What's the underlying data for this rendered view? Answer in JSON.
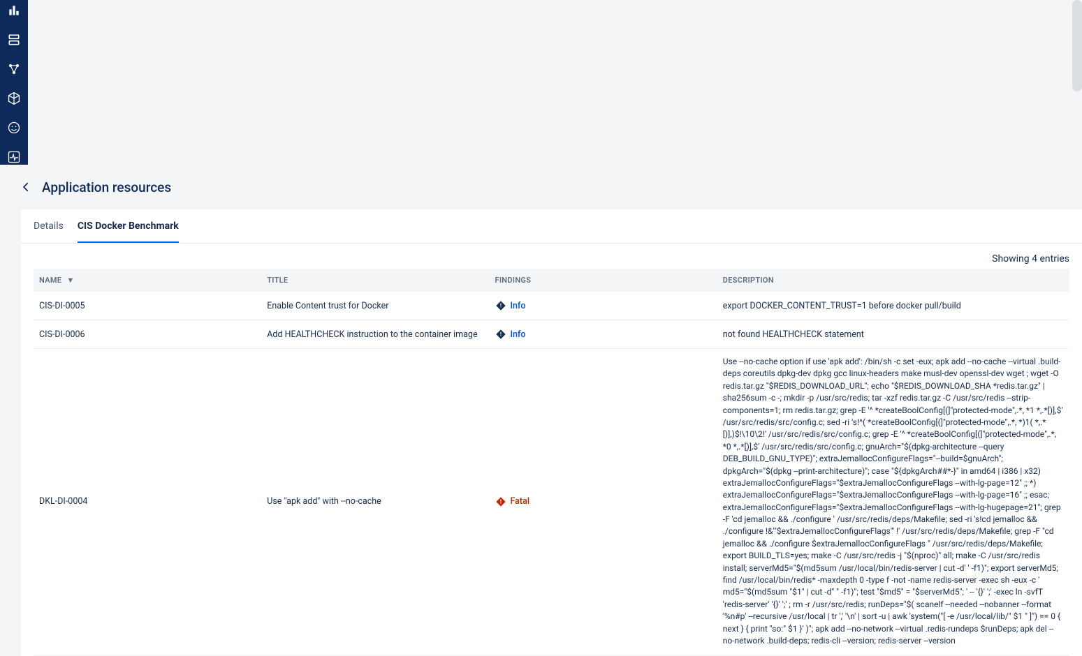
{
  "sidebar": {
    "icons": [
      {
        "name": "bar-chart-icon"
      },
      {
        "name": "server-icon"
      },
      {
        "name": "nodes-icon"
      },
      {
        "name": "cube-icon"
      },
      {
        "name": "smiley-icon"
      },
      {
        "name": "activity-icon"
      }
    ]
  },
  "header": {
    "title": "Application resources"
  },
  "tabs": {
    "items": [
      {
        "label": "Details",
        "active": false
      },
      {
        "label": "CIS Docker Benchmark",
        "active": true
      }
    ]
  },
  "table": {
    "showing": "Showing 4 entries",
    "columns": {
      "name": "NAME",
      "title": "TITLE",
      "findings": "FINDINGS",
      "description": "DESCRIPTION"
    },
    "rows": [
      {
        "name": "CIS-DI-0005",
        "title": "Enable Content trust for Docker",
        "finding_level": "Info",
        "severity": "info",
        "description": "export DOCKER_CONTENT_TRUST=1 before docker pull/build"
      },
      {
        "name": "CIS-DI-0006",
        "title": "Add HEALTHCHECK instruction to the container image",
        "finding_level": "Info",
        "severity": "info",
        "description": "not found HEALTHCHECK statement"
      },
      {
        "name": "DKL-DI-0004",
        "title": "Use \"apk add\" with --no-cache",
        "finding_level": "Fatal",
        "severity": "fatal",
        "description": "Use --no-cache option if use 'apk add': /bin/sh -c set -eux; apk add --no-cache --virtual .build-deps coreutils dpkg-dev dpkg gcc linux-headers make musl-dev openssl-dev wget ; wget -O redis.tar.gz \"$REDIS_DOWNLOAD_URL\"; echo \"$REDIS_DOWNLOAD_SHA *redis.tar.gz\" | sha256sum -c -; mkdir -p /usr/src/redis; tar -xzf redis.tar.gz -C /usr/src/redis --strip-components=1; rm redis.tar.gz; grep -E '^ *createBoolConfig[(]\"protected-mode\",.*, *1 *,.*[)],$' /usr/src/redis/src/config.c; sed -ri 's!^( *createBoolConfig[(]\"protected-mode\",.*, *)1( *,.*[)],)$!\\10\\2!' /usr/src/redis/src/config.c; grep -E '^ *createBoolConfig[(]\"protected-mode\",.*, *0 *,.*[)],$' /usr/src/redis/src/config.c; gnuArch=\"$(dpkg-architecture --query DEB_BUILD_GNU_TYPE)\"; extraJemallocConfigureFlags=\"--build=$gnuArch\"; dpkgArch=\"$(dpkg --print-architecture)\"; case \"${dpkgArch##*-}\" in amd64 | i386 | x32) extraJemallocConfigureFlags=\"$extraJemallocConfigureFlags --with-lg-page=12\" ;; *) extraJemallocConfigureFlags=\"$extraJemallocConfigureFlags --with-lg-page=16\" ;; esac; extraJemallocConfigureFlags=\"$extraJemallocConfigureFlags --with-lg-hugepage=21\"; grep -F 'cd jemalloc && ./configure ' /usr/src/redis/deps/Makefile; sed -ri 's!cd jemalloc && ./configure !&'\"$extraJemallocConfigureFlags\"' !' /usr/src/redis/deps/Makefile; grep -F \"cd jemalloc && ./configure $extraJemallocConfigureFlags \" /usr/src/redis/deps/Makefile; export BUILD_TLS=yes; make -C /usr/src/redis -j \"$(nproc)\" all; make -C /usr/src/redis install; serverMd5=\"$(md5sum /usr/local/bin/redis-server | cut -d' ' -f1)\"; export serverMd5; find /usr/local/bin/redis* -maxdepth 0 -type f -not -name redis-server -exec sh -eux -c ' md5=\"$(md5sum \"$1\" | cut -d\" \" -f1)\"; test \"$md5\" = \"$serverMd5\"; ' -- '{}' ';' -exec ln -svfT 'redis-server' '{}' ';' ; rm -r /usr/src/redis; runDeps=\"$( scanelf --needed --nobanner --format '%n#p' --recursive /usr/local | tr ',' '\\n' | sort -u | awk 'system(\"[ -e /usr/local/lib/\" $1 \" ]\") == 0 { next } { print \"so:\" $1 }' )\"; apk add --no-network --virtual .redis-rundeps $runDeps; apk del --no-network .build-deps; redis-cli --version; redis-server --version"
      }
    ]
  },
  "severity_colors": {
    "info": "#172b4d",
    "fatal": "#bf2600"
  }
}
